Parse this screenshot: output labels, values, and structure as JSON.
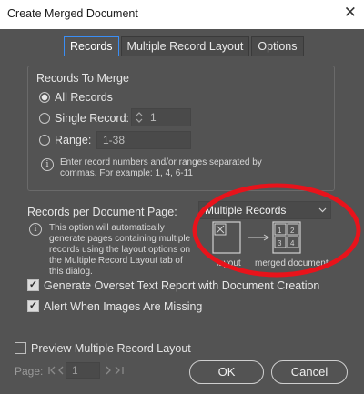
{
  "window": {
    "title": "Create Merged Document",
    "close_glyph": "✕"
  },
  "tabs": [
    {
      "label": "Records"
    },
    {
      "label": "Multiple Record Layout"
    },
    {
      "label": "Options"
    }
  ],
  "records_to_merge": {
    "legend": "Records To Merge",
    "all_label": "All Records",
    "single_label": "Single Record:",
    "single_value": "1",
    "range_label": "Range:",
    "range_placeholder": "1-38",
    "hint": "Enter record numbers and/or ranges separated by commas. For example: 1, 4, 6-11"
  },
  "per_page": {
    "label": "Records per Document Page:",
    "selected": "Multiple Records",
    "info": "This option will automatically generate pages containing multiple records using the layout options on the Multiple Record Layout tab of this dialog.",
    "layout_caption": "layout",
    "merged_caption": "merged document",
    "grid_labels": [
      "1",
      "2",
      "3",
      "4"
    ]
  },
  "options": {
    "overset_label": "Generate Overset Text Report with Document Creation",
    "overset_checked": true,
    "alert_label": "Alert When Images Are Missing",
    "alert_checked": true,
    "preview_label": "Preview Multiple Record Layout",
    "preview_checked": false
  },
  "pager": {
    "label": "Page:",
    "value": "1"
  },
  "buttons": {
    "ok": "OK",
    "cancel": "Cancel"
  },
  "colors": {
    "annotation": "#e8131b",
    "focus": "#3a8ef6"
  }
}
